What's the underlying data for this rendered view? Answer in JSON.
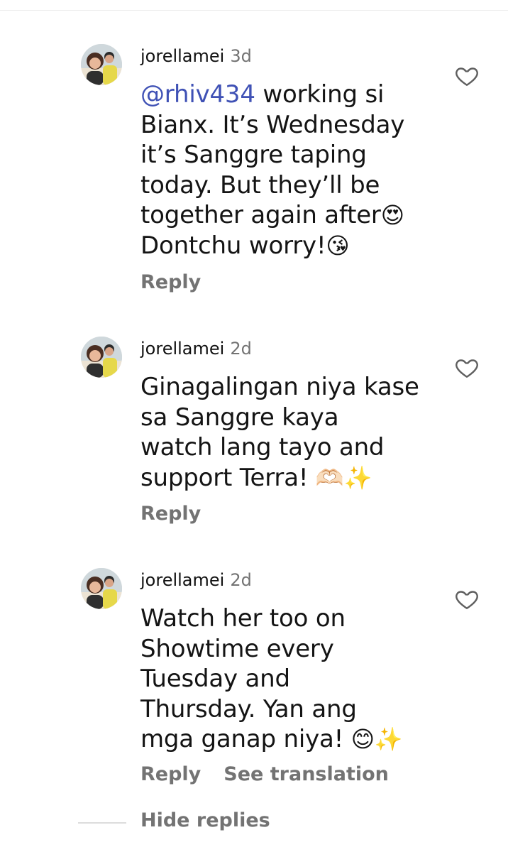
{
  "comments": [
    {
      "username": "jorellamei",
      "time": "3d",
      "mention": "@rhiv434",
      "text_lines": [
        " working si",
        "Bianx. It’s Wednesday",
        "it’s Sanggre taping",
        "today. But they’ll be",
        "together again after",
        "Dontchu worry!"
      ],
      "emojis": [
        "😍",
        "😘"
      ],
      "actions": [
        "Reply"
      ]
    },
    {
      "username": "jorellamei",
      "time": "2d",
      "text_lines": [
        "Ginagalingan niya kase",
        "sa Sanggre kaya",
        "watch lang tayo and",
        "support Terra! "
      ],
      "emojis": [
        "🫶🏻",
        "✨"
      ],
      "actions": [
        "Reply"
      ]
    },
    {
      "username": "jorellamei",
      "time": "2d",
      "text_lines": [
        "Watch her too on",
        "Showtime every",
        "Tuesday and",
        "Thursday. Yan ang",
        "mga ganap niya! "
      ],
      "emojis": [
        "😊",
        "✨"
      ],
      "actions": [
        "Reply",
        "See translation"
      ]
    }
  ],
  "footer": {
    "hide_replies": "Hide replies"
  },
  "icons": {
    "avatar": "profile-photo",
    "like": "heart-outline-icon"
  },
  "colors": {
    "mention": "#3f51b5",
    "secondary_text": "#737373"
  }
}
